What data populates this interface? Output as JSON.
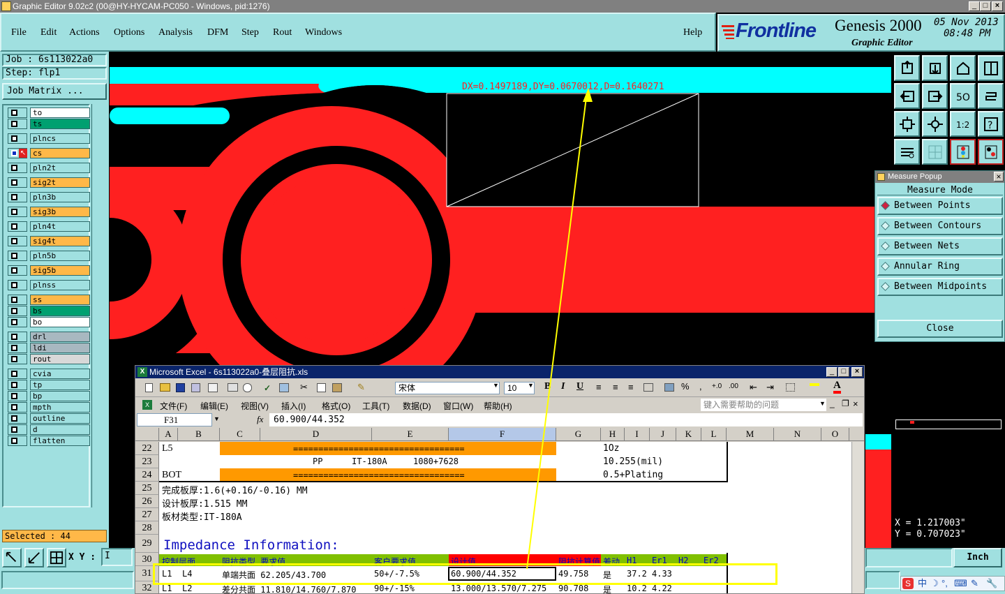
{
  "window": {
    "title": "Graphic Editor 9.02c2 (00@HY-HYCAM-PC050 - Windows, pid:1276)"
  },
  "menu": {
    "items": [
      "File",
      "Edit",
      "Actions",
      "Options",
      "Analysis",
      "DFM",
      "Step",
      "Rout",
      "Windows"
    ],
    "help": "Help"
  },
  "brand": {
    "logo": "Frontline",
    "product": "Genesis 2000",
    "subtitle": "Graphic Editor",
    "date": "05 Nov 2013",
    "time": "08:48 PM"
  },
  "job": {
    "job_label": "Job : 6s113022a0",
    "step_label": "Step: flp1",
    "matrix_button": "Job Matrix ..."
  },
  "layers": [
    {
      "name": "to",
      "color": "#ffffff"
    },
    {
      "name": "ts",
      "color": "#00a070"
    },
    {
      "name": "plncs",
      "color": "#a0e0e0"
    },
    {
      "name": "cs",
      "color": "#ffb848",
      "active": true
    },
    {
      "name": "pln2t",
      "color": "#a0e0e0"
    },
    {
      "name": "sig2t",
      "color": "#ffb848"
    },
    {
      "name": "pln3b",
      "color": "#a0e0e0"
    },
    {
      "name": "sig3b",
      "color": "#ffb848"
    },
    {
      "name": "pln4t",
      "color": "#a0e0e0"
    },
    {
      "name": "sig4t",
      "color": "#ffb848"
    },
    {
      "name": "pln5b",
      "color": "#a0e0e0"
    },
    {
      "name": "sig5b",
      "color": "#ffb848"
    },
    {
      "name": "plnss",
      "color": "#a0e0e0"
    },
    {
      "name": "ss",
      "color": "#ffb848"
    },
    {
      "name": "bs",
      "color": "#00a070"
    },
    {
      "name": "bo",
      "color": "#ffffff"
    },
    {
      "name": "drl",
      "color": "#a8b8c0"
    },
    {
      "name": "ldi",
      "color": "#a8b8c0"
    },
    {
      "name": "rout",
      "color": "#d8d8d8"
    },
    {
      "name": "cvia",
      "color": "#a0e0e0"
    },
    {
      "name": "tp",
      "color": "#a0e0e0"
    },
    {
      "name": "bp",
      "color": "#a0e0e0"
    },
    {
      "name": "mpth",
      "color": "#a0e0e0"
    },
    {
      "name": "outline",
      "color": "#a0e0e0"
    },
    {
      "name": "d",
      "color": "#a0e0e0"
    },
    {
      "name": "flatten",
      "color": "#a0e0e0"
    }
  ],
  "selected": "Selected : 44",
  "measurement": {
    "text": "DX=0.1497189,DY=0.0670012,D=0.1640271"
  },
  "measure_popup": {
    "title": "Measure Popup",
    "header": "Measure Mode",
    "options": [
      "Between Points",
      "Between Contours",
      "Between Nets",
      "Annular Ring",
      "Between Midpoints"
    ],
    "close": "Close"
  },
  "coords": {
    "x": "X = 1.217003\"",
    "y": "Y = 0.707023\""
  },
  "status": {
    "xy_label": "X Y :",
    "xy_value": "I",
    "units": "Inch"
  },
  "excel": {
    "title": "Microsoft Excel - 6s113022a0-叠层阻抗.xls",
    "font": "宋体",
    "size": "10",
    "menus": [
      "文件(F)",
      "编辑(E)",
      "视图(V)",
      "插入(I)",
      "格式(O)",
      "工具(T)",
      "数据(D)",
      "窗口(W)",
      "帮助(H)"
    ],
    "help_placeholder": "键入需要帮助的问题",
    "cell_ref": "F31",
    "fx": "fx",
    "formula": "60.900/44.352",
    "columns": [
      "A",
      "B",
      "C",
      "D",
      "E",
      "F",
      "G",
      "H",
      "I",
      "J",
      "K",
      "L",
      "M",
      "N",
      "O"
    ],
    "rows": {
      "r22": {
        "num": "22",
        "a": "L5",
        "bar": "==================================",
        "h": "1Oz"
      },
      "r23": {
        "num": "23",
        "pp": "PP",
        "mat": "IT-180A",
        "glass": "1080+7628",
        "h": "10.255(mil)"
      },
      "r24": {
        "num": "24",
        "a": "BOT",
        "bar": "==================================",
        "h": "0.5+Plating"
      },
      "r25": {
        "num": "25",
        "a": "完成板厚:1.6(+0.16/-0.16) MM"
      },
      "r26": {
        "num": "26",
        "a": "设计板厚:1.515 MM"
      },
      "r27": {
        "num": "27",
        "a": "板材类型:IT-180A"
      },
      "r28": {
        "num": "28"
      },
      "r29": {
        "num": "29",
        "a": "Impedance Information:"
      },
      "r30": {
        "num": "30",
        "a": "控制层面",
        "c": "阻抗类型 要求值",
        "e": "客户要求值",
        "f": "设计值",
        "g": "阻抗计算值",
        "h": "差动",
        "i": "H1",
        "j": "Er1",
        "k": "H2",
        "l": "Er2"
      },
      "r31": {
        "num": "31",
        "a": "L1",
        "b": "L4",
        "c": "单端共面 62.205/43.700",
        "e": "50+/-7.5%",
        "f": "60.900/44.352",
        "g": "49.758",
        "h": "是",
        "i": "37.2",
        "j": "4.33"
      },
      "r32": {
        "num": "32",
        "a": "L1",
        "b": "L2",
        "c": "差分共面 11.810/14.760/7.870",
        "e": "90+/-15%",
        "f": "13.000/13.570/7.275",
        "g": "90.708",
        "h": "是",
        "i": "10.2",
        "j": "4.22"
      }
    }
  },
  "tray": [
    "中",
    "☽",
    "°,",
    "⌨",
    "✎",
    "🔧"
  ]
}
